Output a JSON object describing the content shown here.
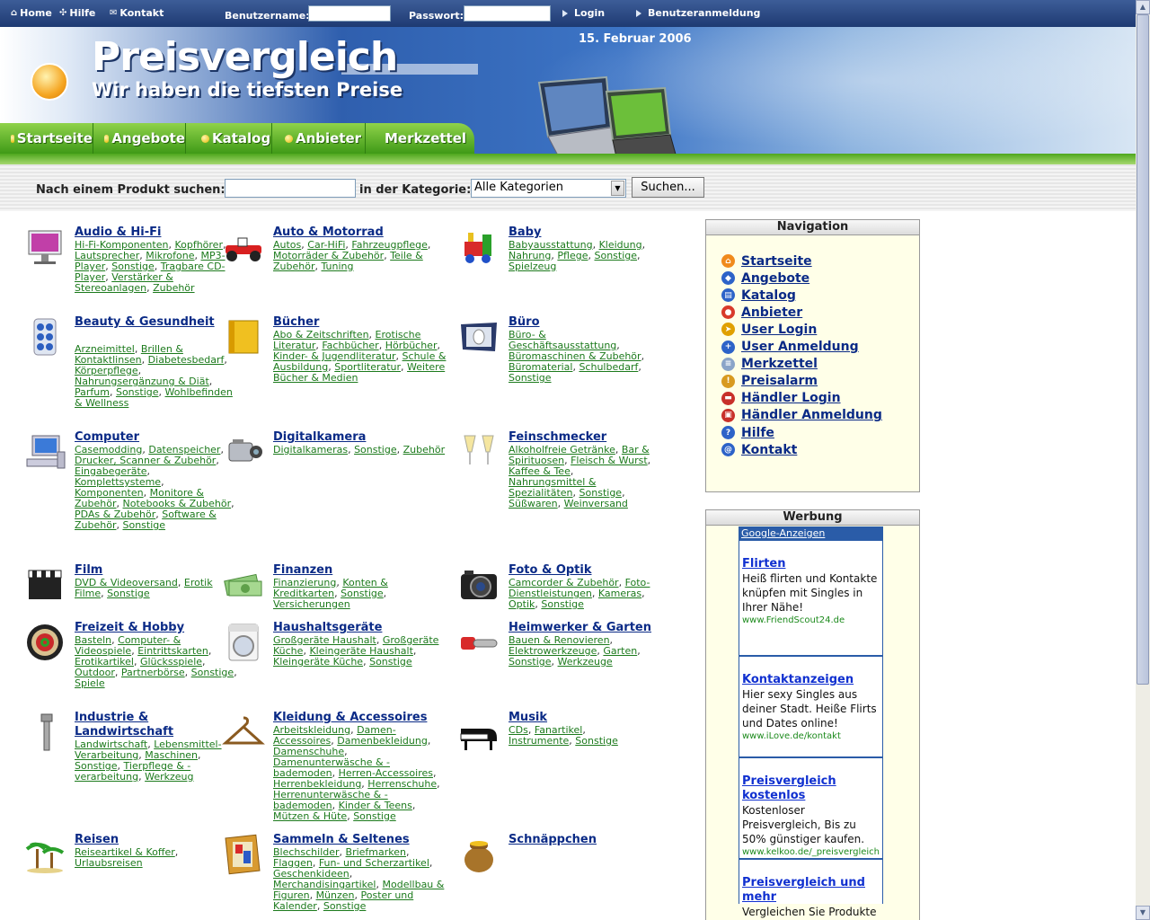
{
  "topbar": {
    "home": "Home",
    "help": "Hilfe",
    "contact": "Kontakt",
    "username_label": "Benutzername:",
    "password_label": "Passwort:",
    "login": "Login",
    "register": "Benutzeranmeldung"
  },
  "banner": {
    "title": "Preisvergleich",
    "subtitle": "Wir haben die tiefsten Preise",
    "date": "15. Februar 2006"
  },
  "nav_tabs": [
    "Startseite",
    "Angebote",
    "Katalog",
    "Anbieter",
    "Merkzettel"
  ],
  "search": {
    "label": "Nach einem Produkt suchen:",
    "category_label": "in der Kategorie:",
    "category_value": "Alle Kategorien",
    "button": "Suchen..."
  },
  "categories": [
    {
      "title": "Audio & Hi-Fi",
      "icon": "tv-icon",
      "subs": [
        "Hi-Fi-Komponenten",
        "Kopfhörer",
        "Lautsprecher",
        "Mikrofone",
        "MP3-Player",
        "Sonstige",
        "Tragbare CD-Player",
        "Verstärker & Stereoanlagen",
        "Zubehör"
      ]
    },
    {
      "title": "Auto & Motorrad",
      "icon": "race-car-icon",
      "subs": [
        "Autos",
        "Car-HiFi",
        "Fahrzeugpflege",
        "Motorräder & Zubehör",
        "Teile & Zubehör",
        "Tuning"
      ]
    },
    {
      "title": "Baby",
      "icon": "toy-train-icon",
      "subs": [
        "Babyausstattung",
        "Kleidung",
        "Nahrung",
        "Pflege",
        "Sonstige",
        "Spielzeug"
      ]
    },
    {
      "title": "Beauty & Gesundheit",
      "icon": "pills-icon",
      "subs": [
        "Arzneimittel",
        "Brillen & Kontaktlinsen",
        "Diabetesbedarf",
        "Körperpflege",
        "Nahrungsergänzung & Diät",
        "Parfum",
        "Sonstige",
        "Wohlbefinden & Wellness"
      ]
    },
    {
      "title": "Bücher",
      "icon": "book-icon",
      "subs": [
        "Abo & Zeitschriften",
        "Erotische Literatur",
        "Fachbücher",
        "Hörbücher",
        "Kinder- & Jugendliteratur",
        "Schule & Ausbildung",
        "Sportliteratur",
        "Weitere Bücher & Medien"
      ]
    },
    {
      "title": "Büro",
      "icon": "mouse-pad-icon",
      "subs": [
        "Büro- & Geschäftsausstattung",
        "Büromaschinen & Zubehör",
        "Büromaterial",
        "Schulbedarf",
        "Sonstige"
      ]
    },
    {
      "title": "Computer",
      "icon": "computer-icon",
      "subs": [
        "Casemodding",
        "Datenspeicher",
        "Drucker, Scanner & Zubehör",
        "Eingabegeräte",
        "Komplettsysteme",
        "Komponenten",
        "Monitore & Zubehör",
        "Notebooks & Zubehör",
        "PDAs & Zubehör",
        "Software & Zubehör",
        "Sonstige"
      ]
    },
    {
      "title": "Digitalkamera",
      "icon": "camcorder-icon",
      "subs": [
        "Digitalkameras",
        "Sonstige",
        "Zubehör"
      ]
    },
    {
      "title": "Feinschmecker",
      "icon": "champagne-glasses-icon",
      "subs": [
        "Alkoholfreie Getränke",
        "Bar & Spirituosen",
        "Fleisch & Wurst",
        "Kaffee & Tee",
        "Nahrungsmittel & Spezialitäten",
        "Sonstige",
        "Süßwaren",
        "Weinversand"
      ]
    },
    {
      "title": "Film",
      "icon": "clapperboard-icon",
      "subs": [
        "DVD & Videoversand",
        "Erotik Filme",
        "Sonstige"
      ]
    },
    {
      "title": "Finanzen",
      "icon": "money-icon",
      "subs": [
        "Finanzierung",
        "Konten & Kreditkarten",
        "Sonstige",
        "Versicherungen"
      ]
    },
    {
      "title": "Foto & Optik",
      "icon": "camera-icon",
      "subs": [
        "Camcorder & Zubehör",
        "Foto-Dienstleistungen",
        "Kameras",
        "Optik",
        "Sonstige"
      ]
    },
    {
      "title": "Freizeit & Hobby",
      "icon": "dartboard-icon",
      "subs": [
        "Basteln",
        "Computer- & Videospiele",
        "Eintrittskarten",
        "Erotikartikel",
        "Glücksspiele",
        "Outdoor",
        "Partnerbörse",
        "Sonstige",
        "Spiele"
      ]
    },
    {
      "title": "Haushaltsgeräte",
      "icon": "washing-machine-icon",
      "subs": [
        "Großgeräte Haushalt",
        "Großgeräte Küche",
        "Kleingeräte Haushalt",
        "Kleingeräte Küche",
        "Sonstige"
      ]
    },
    {
      "title": "Heimwerker & Garten",
      "icon": "chainsaw-icon",
      "subs": [
        "Bauen & Renovieren",
        "Elektrowerkzeuge",
        "Garten",
        "Sonstige",
        "Werkzeuge"
      ]
    },
    {
      "title": "Industrie & Landwirtschaft",
      "icon": "bolt-screw-icon",
      "subs": [
        "Landwirtschaft",
        "Lebensmittel-Verarbeitung",
        "Maschinen",
        "Sonstige",
        "Tierpflege & -verarbeitung",
        "Werkzeug"
      ]
    },
    {
      "title": "Kleidung & Accessoires",
      "icon": "hanger-icon",
      "subs": [
        "Arbeitskleidung",
        "Damen-Accessoires",
        "Damenbekleidung",
        "Damenschuhe",
        "Damenunterwäsche & -bademoden",
        "Herren-Accessoires",
        "Herrenbekleidung",
        "Herrenschuhe",
        "Herrenunterwäsche & -bademoden",
        "Kinder & Teens",
        "Mützen & Hüte",
        "Sonstige"
      ]
    },
    {
      "title": "Musik",
      "icon": "piano-icon",
      "subs": [
        "CDs",
        "Fanartikel",
        "Instrumente",
        "Sonstige"
      ]
    },
    {
      "title": "Reisen",
      "icon": "palm-trees-icon",
      "subs": [
        "Reiseartikel & Koffer",
        "Urlaubsreisen"
      ]
    },
    {
      "title": "Sammeln & Seltenes",
      "icon": "picture-frame-icon",
      "subs": [
        "Blechschilder",
        "Briefmarken",
        "Flaggen",
        "Fun- und Scherzartikel",
        "Geschenkideen",
        "Merchandisingartikel",
        "Modellbau & Figuren",
        "Münzen",
        "Poster und Kalender",
        "Sonstige"
      ]
    },
    {
      "title": "Schnäppchen",
      "icon": "money-pot-icon",
      "subs": []
    }
  ],
  "navigation": {
    "title": "Navigation",
    "items": [
      {
        "label": "Startseite",
        "icon": "home-icon",
        "color": "#f08a1c"
      },
      {
        "label": "Angebote",
        "icon": "offers-icon",
        "color": "#2d63c8"
      },
      {
        "label": "Katalog",
        "icon": "catalog-icon",
        "color": "#2d63c8"
      },
      {
        "label": "Anbieter",
        "icon": "vendor-icon",
        "color": "#d83a2a"
      },
      {
        "label": "User Login",
        "icon": "login-icon",
        "color": "#e0a000"
      },
      {
        "label": "User Anmeldung",
        "icon": "user-register-icon",
        "color": "#2d63c8"
      },
      {
        "label": "Merkzettel",
        "icon": "notepad-icon",
        "color": "#8aa4c8"
      },
      {
        "label": "Preisalarm",
        "icon": "alarm-icon",
        "color": "#d89a20"
      },
      {
        "label": "Händler Login",
        "icon": "dealer-login-icon",
        "color": "#c8302a"
      },
      {
        "label": "Händler Anmeldung",
        "icon": "dealer-register-icon",
        "color": "#c8302a"
      },
      {
        "label": "Hilfe",
        "icon": "help-icon",
        "color": "#2d63c8"
      },
      {
        "label": "Kontakt",
        "icon": "contact-icon",
        "color": "#2d63c8"
      }
    ]
  },
  "ads": {
    "title": "Werbung",
    "google_label": "Google-Anzeigen",
    "items": [
      {
        "title": "Flirten",
        "text": "Heiß flirten und Kontakte knüpfen mit Singles in Ihrer Nähe!",
        "url": "www.FriendScout24.de"
      },
      {
        "title": "Kontaktanzeigen",
        "text": "Hier sexy Singles aus deiner Stadt. Heiße Flirts und Dates online!",
        "url": "www.iLove.de/kontakt"
      },
      {
        "title": "Preisvergleich kostenlos",
        "text": "Kostenloser Preisvergleich, Bis zu 50% günstiger kaufen.",
        "url": "www.kelkoo.de/_preisvergleich"
      },
      {
        "title": "Preisvergleich und mehr",
        "text": "Vergleichen Sie Produkte aller Art bei preisauskunft.de !",
        "url": ""
      }
    ]
  }
}
